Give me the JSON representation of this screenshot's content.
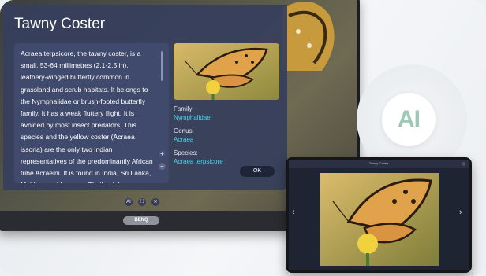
{
  "panel": {
    "title": "Tawny Coster",
    "description": "Acraea terpsicore, the tawny coster, is a small, 53-64 millimetres (2.1-2.5 in), leathery-winged butterfly common in grassland and scrub habitats. It belongs to the Nymphalidae or brush-footed butterfly family. It has a weak fluttery flight. It is avoided by most insect predators. This species and the yellow coster (Acraea issoria) are the only two Indian representatives of the predominantly African tribe Acraeini. It is found in India, Sri Lanka, Maldives to Myanmar, Thailand, Laos, Cambodia, Vietnam, Bangladesh, Singapore",
    "family_label": "Family:",
    "family_value": "Nymphalidae",
    "genus_label": "Genus:",
    "genus_value": "Acraea",
    "species_label": "Species:",
    "species_value": "Acraea terpsicore",
    "ok_label": "OK",
    "zoom_in_symbol": "+",
    "zoom_out_symbol": "−"
  },
  "toolbar": {
    "ai_symbol": "AI",
    "fit_symbol": "⛶",
    "close_symbol": "✕"
  },
  "display_bar": {
    "handle_label": "BENQ"
  },
  "badge": {
    "text": "AI"
  },
  "tablet": {
    "title_text": "Tawny Coster",
    "prev_symbol": "‹",
    "next_symbol": "›"
  },
  "colors": {
    "panel_bg": "#363e5c",
    "accent_cyan": "#45d8f0",
    "ai_badge_green": "#9cc8b4"
  }
}
